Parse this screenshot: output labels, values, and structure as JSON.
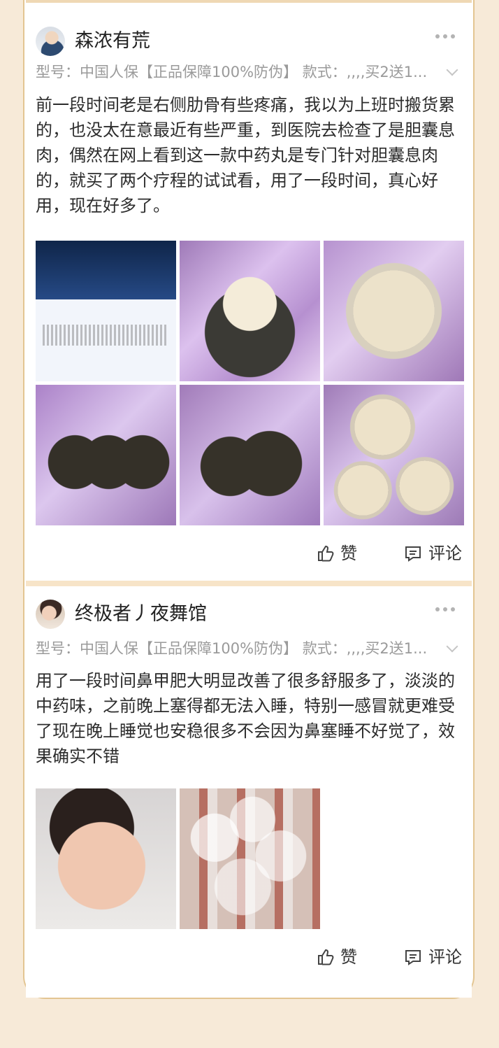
{
  "reviews": [
    {
      "username": "森浓有荒",
      "spec": "型号：中国人保【正品保障100%防伪】 款式：,,,,买2送1...",
      "text": "前一段时间老是右侧肋骨有些疼痛，我以为上班时搬货累的，也没太在意最近有些严重，到医院去检查了是胆囊息肉，偶然在网上看到这一款中药丸是专门针对胆囊息肉的，就买了两个疗程的试试看，用了一段时间，真心好用，现在好多了。",
      "actions": {
        "like": "赞",
        "comment": "评论"
      }
    },
    {
      "username": "终极者丿夜舞馆",
      "spec": "型号：中国人保【正品保障100%防伪】 款式：,,,,买2送1...",
      "text": "用了一段时间鼻甲肥大明显改善了很多舒服多了，淡淡的中药味，之前晚上塞得都无法入睡，特别一感冒就更难受了现在晚上睡觉也安稳很多不会因为鼻塞睡不好觉了，效果确实不错",
      "actions": {
        "like": "赞",
        "comment": "评论"
      }
    }
  ],
  "icons": {
    "more": "more-icon",
    "dropdown": "chevron-down-icon",
    "like": "thumb-up-icon",
    "comment": "comment-icon"
  },
  "colors": {
    "background": "#f7ead8",
    "border": "#e3c592",
    "card": "#ffffff",
    "muted_text": "#9a9a9a",
    "main_text": "#2c2c2c"
  }
}
